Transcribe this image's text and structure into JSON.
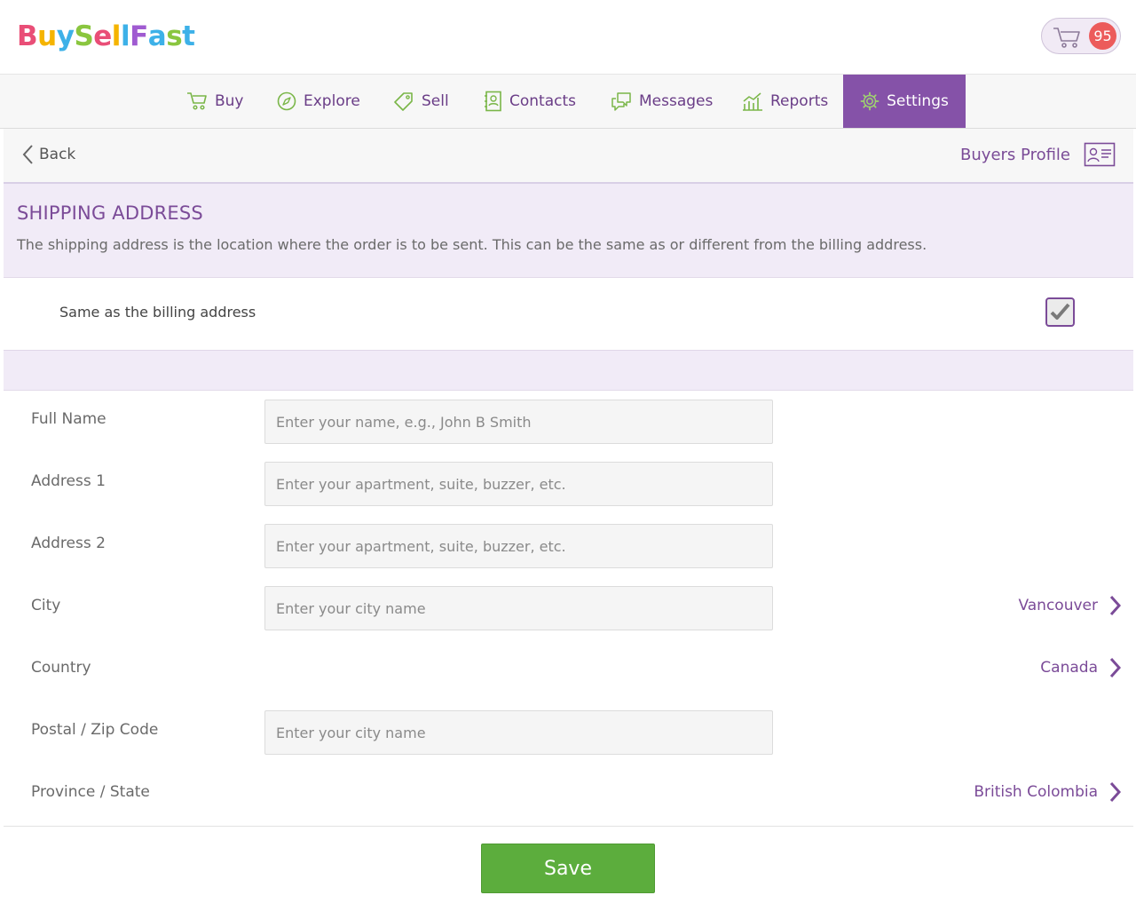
{
  "app": {
    "logo_text": "BuySellFast",
    "logo_colors": [
      "#e94e77",
      "#f5b400",
      "#3db1e8",
      "#8ac63f",
      "#a05bd1"
    ],
    "cart_count": "95"
  },
  "nav": {
    "items": [
      {
        "label": "Buy",
        "icon": "cart-icon"
      },
      {
        "label": "Explore",
        "icon": "compass-icon"
      },
      {
        "label": "Sell",
        "icon": "tag-icon"
      },
      {
        "label": "Contacts",
        "icon": "address-book-icon"
      },
      {
        "label": "Messages",
        "icon": "chat-icon"
      },
      {
        "label": "Reports",
        "icon": "chart-icon"
      },
      {
        "label": "Settings",
        "icon": "gear-icon",
        "active": true
      }
    ]
  },
  "subheader": {
    "back_label": "Back",
    "profile_label": "Buyers Profile"
  },
  "section": {
    "title": "SHIPPING ADDRESS",
    "description": "The shipping address is the location where the order is to be sent. This can be the same as or different from the billing address."
  },
  "same_as_billing": {
    "label": "Same as the billing address",
    "checked": true
  },
  "form": {
    "full_name": {
      "label": "Full Name",
      "placeholder": "Enter your name, e.g., John B Smith"
    },
    "address1": {
      "label": "Address 1",
      "placeholder": "Enter your apartment, suite, buzzer, etc."
    },
    "address2": {
      "label": "Address 2",
      "placeholder": "Enter your apartment, suite, buzzer, etc."
    },
    "city": {
      "label": "City",
      "placeholder": "Enter your city name",
      "selected": "Vancouver"
    },
    "country": {
      "label": "Country",
      "selected": "Canada"
    },
    "postal": {
      "label": "Postal / Zip Code",
      "placeholder": "Enter your city name"
    },
    "province": {
      "label": "Province / State",
      "selected": "British Colombia"
    }
  },
  "actions": {
    "save_label": "Save"
  },
  "colors": {
    "brand_purple": "#7b4b98",
    "nav_active_bg": "#8552a8",
    "nav_icon_green": "#7ab648",
    "save_green": "#5cad3d",
    "badge_red": "#ec5b5b"
  }
}
